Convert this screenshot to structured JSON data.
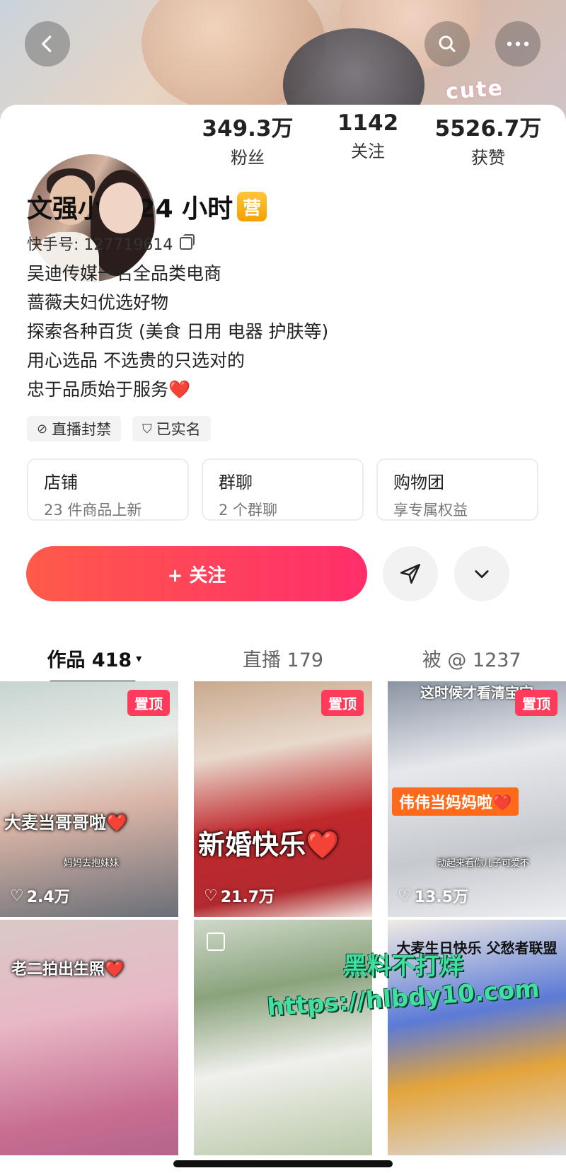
{
  "cover": {
    "sticker_text": "cute"
  },
  "header": {
    "back_icon": "chevron-left-icon",
    "search_icon": "search-icon",
    "more_icon": "more-dots-icon"
  },
  "stats": [
    {
      "value": "349.3万",
      "label": "粉丝"
    },
    {
      "value": "1142",
      "label": "关注"
    },
    {
      "value": "5526.7万",
      "label": "获赞"
    }
  ],
  "profile": {
    "name": "文强小店 24 小时",
    "badge": "营",
    "uid_label": "快手号: 127719614",
    "bio": [
      "吴迪传媒一名全品类电商",
      "蔷薇夫妇优选好物",
      "探索各种百货 (美食 日用 电器 护肤等)",
      "用心选品 不选贵的只选对的",
      "忠于品质始于服务"
    ],
    "bio_heart": "❤️"
  },
  "tags": [
    {
      "icon": "⊘",
      "label": "直播封禁"
    },
    {
      "icon": "⛉",
      "label": "已实名"
    }
  ],
  "tiles": [
    {
      "title": "店铺",
      "subtitle": "23 件商品上新"
    },
    {
      "title": "群聊",
      "subtitle": "2 个群聊"
    },
    {
      "title": "购物团",
      "subtitle": "享专属权益"
    }
  ],
  "actions": {
    "follow_label": "+ 关注"
  },
  "tabs": [
    {
      "label": "作品 418",
      "caret": "▾"
    },
    {
      "label": "直播 179"
    },
    {
      "label": "被 @ 1237"
    }
  ],
  "grid": [
    {
      "pinned": "置顶",
      "top_text": "",
      "caption": "大麦当哥哥啦",
      "heart": "❤️",
      "sub": "妈妈去抱妹妹",
      "likes": "2.4万"
    },
    {
      "pinned": "置顶",
      "top_text": "",
      "caption": "新婚快乐",
      "heart": "❤️",
      "sub": "",
      "likes": "21.7万"
    },
    {
      "pinned": "置顶",
      "top_text": "这时候才看清宝宝",
      "caption": "伟伟当妈妈啦",
      "heart": "❤️",
      "sub": "动起来看你儿子可爱不",
      "likes": "13.5万"
    },
    {
      "pinned": "",
      "top_text": "",
      "caption": "老二拍出生照",
      "heart": "❤️",
      "sub": "",
      "likes": ""
    },
    {
      "pinned": "",
      "top_text": "",
      "caption": "",
      "heart": "",
      "sub": "",
      "likes": ""
    },
    {
      "pinned": "",
      "top_text": "大麦生日快乐 父愁者联盟",
      "caption": "",
      "heart": "",
      "sub": "",
      "likes": ""
    }
  ],
  "watermark": {
    "line1": "黑料不打烊",
    "line2": "https://hlbdy10.com"
  }
}
